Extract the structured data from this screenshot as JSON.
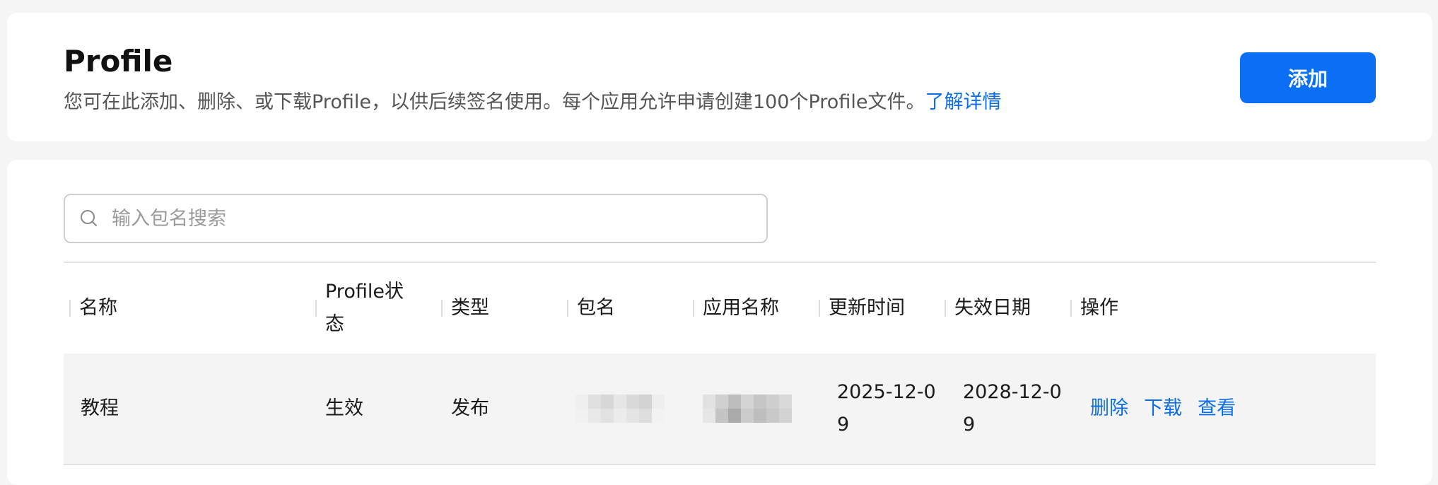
{
  "header": {
    "title": "Profile",
    "description": "您可在此添加、删除、或下载Profile，以供后续签名使用。每个应用允许申请创建100个Profile文件。",
    "learn_more": "了解详情",
    "add_button": "添加"
  },
  "search": {
    "placeholder": "输入包名搜索",
    "value": ""
  },
  "table": {
    "columns": [
      "名称",
      "Profile状态",
      "类型",
      "包名",
      "应用名称",
      "更新时间",
      "失效日期",
      "操作"
    ],
    "rows": [
      {
        "name": "教程",
        "status": "生效",
        "type": "发布",
        "package_name": "",
        "app_name": "",
        "updated": "2025-12-09",
        "expires": "2028-12-09",
        "actions": [
          "删除",
          "下载",
          "查看"
        ]
      }
    ]
  },
  "colors": {
    "accent": "#0a6ff5",
    "link": "#0a6ee8",
    "background": "#f5f5f5"
  }
}
